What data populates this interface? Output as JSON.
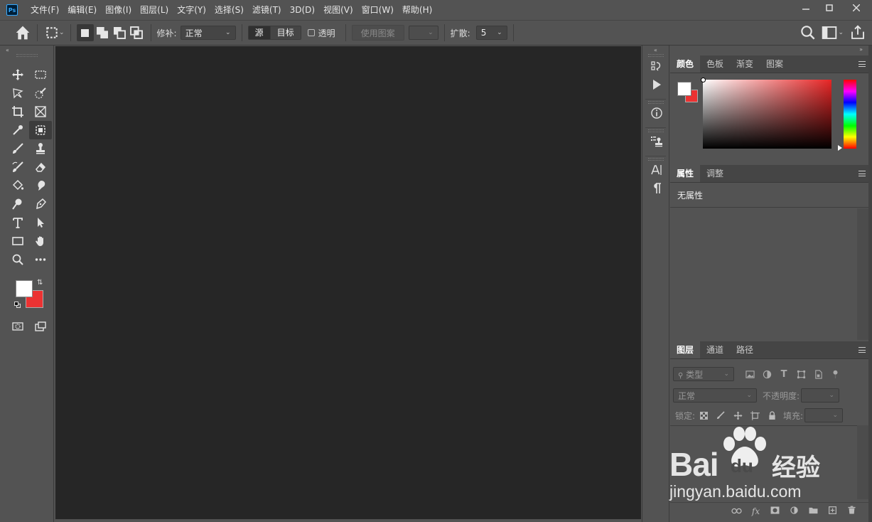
{
  "menubar": {
    "app_icon": "Ps",
    "items": [
      "文件(F)",
      "编辑(E)",
      "图像(I)",
      "图层(L)",
      "文字(Y)",
      "选择(S)",
      "滤镜(T)",
      "3D(D)",
      "视图(V)",
      "窗口(W)",
      "帮助(H)"
    ],
    "window_controls": [
      "minimize-icon",
      "maximize-icon",
      "close-icon"
    ]
  },
  "options_bar": {
    "repair_label": "修补:",
    "repair_mode": "正常",
    "source_label": "源",
    "target_label": "目标",
    "transparent_label": "透明",
    "transparent_checked": false,
    "use_pattern_label": "使用图案",
    "diffusion_label": "扩散:",
    "diffusion_value": "5"
  },
  "color_panel": {
    "tabs": [
      "颜色",
      "色板",
      "渐变",
      "图案"
    ],
    "active_tab": "颜色",
    "foreground": "#ffffff",
    "background": "#ec3232"
  },
  "properties_panel": {
    "tabs": [
      "属性",
      "调整"
    ],
    "active_tab": "属性",
    "content": "无属性"
  },
  "layers_panel": {
    "tabs": [
      "图层",
      "通道",
      "路径"
    ],
    "active_tab": "图层",
    "filter_placeholder": "类型",
    "blend_mode": "正常",
    "opacity_label": "不透明度:",
    "lock_label": "锁定:",
    "fill_label": "填充:"
  },
  "watermark": {
    "brand": "Bai",
    "brand_du": "du",
    "brand_cn": "经验",
    "url": "jingyan.baidu.com"
  },
  "colors": {
    "ui_bg": "#535353",
    "canvas": "#262626",
    "fg_swatch": "#ffffff",
    "bg_swatch": "#ec3232"
  }
}
